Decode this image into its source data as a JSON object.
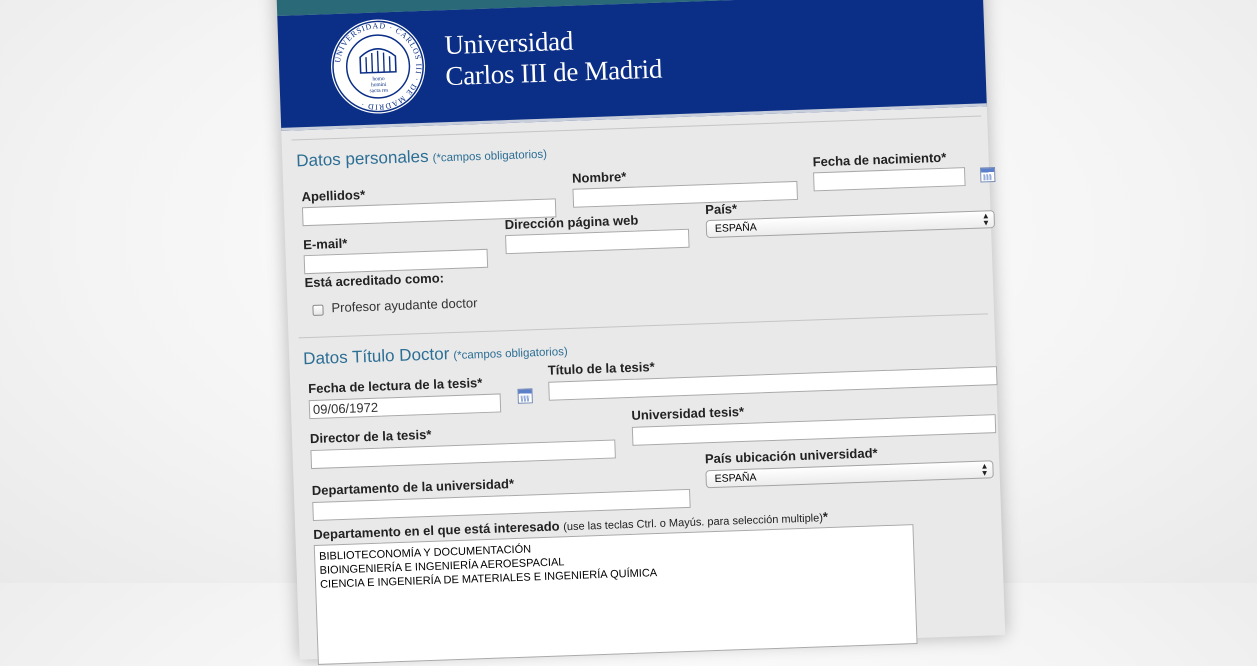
{
  "header": {
    "university_line1": "Universidad",
    "university_line2": "Carlos III de Madrid",
    "seal_text": "UNIVERSIDAD CARLOS III DE MADRID",
    "seal_motto": "homo homini sacra res"
  },
  "personal": {
    "title": "Datos personales",
    "note": "(*campos obligatorios)",
    "apellidos_label": "Apellidos*",
    "apellidos_value": "",
    "nombre_label": "Nombre*",
    "nombre_value": "",
    "fecha_nacimiento_label": "Fecha de nacimiento*",
    "fecha_nacimiento_value": "",
    "email_label": "E-mail*",
    "email_value": "",
    "web_label": "Dirección página web",
    "web_value": "",
    "pais_label": "País*",
    "pais_value": "ESPAÑA",
    "acreditado_label": "Está acreditado como:",
    "checkbox_label": "Profesor ayudante doctor"
  },
  "doctor": {
    "title": "Datos Título Doctor",
    "note": "(*campos obligatorios)",
    "fecha_lectura_label": "Fecha de lectura de la tesis*",
    "fecha_lectura_value": "09/06/1972",
    "titulo_label": "Título de la tesis*",
    "titulo_value": "",
    "director_label": "Director de la tesis*",
    "director_value": "",
    "universidad_label": "Universidad tesis*",
    "universidad_value": "",
    "departamento_label": "Departamento de la universidad*",
    "departamento_value": "",
    "pais_ubicacion_label": "País ubicación universidad*",
    "pais_ubicacion_value": "ESPAÑA",
    "interesado_label": "Departamento en el que está interesado",
    "interesado_hint": "(use las teclas Ctrl. o Mayús. para selección multiple)",
    "interesado_required": "*",
    "departamentos": [
      "BIBLIOTECONOMÍA Y DOCUMENTACIÓN",
      "BIOINGENIERÍA E INGENIERÍA AEROESPACIAL",
      "CIENCIA E INGENIERÍA DE MATERIALES E INGENIERÍA QUÍMICA"
    ]
  },
  "colors": {
    "banner": "#0b2f86",
    "top_strip": "#2a6a78",
    "section_title": "#2c6e94",
    "form_background": "#e9e9e9"
  },
  "icons": [
    "calendar-icon",
    "select-arrows-icon",
    "university-seal"
  ]
}
